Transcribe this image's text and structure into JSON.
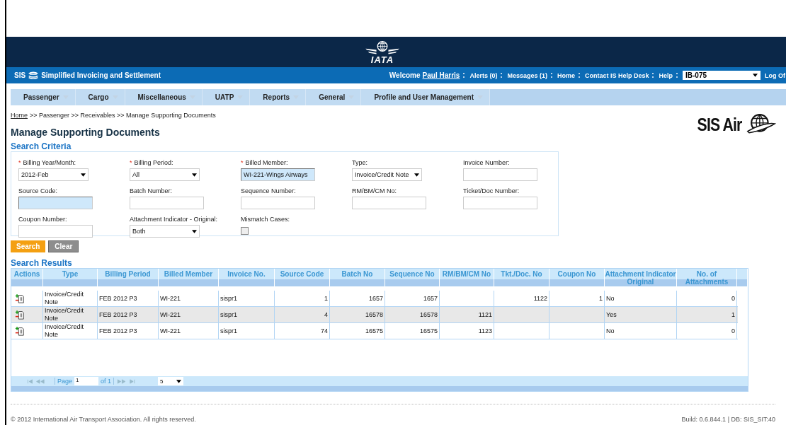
{
  "banner": {
    "logo_text": "IATA"
  },
  "app_bar": {
    "brand": "SIS",
    "title": "Simplified Invoicing and Settlement",
    "welcome": "Welcome",
    "user": "Paul Harris",
    "links": [
      "Alerts (0)",
      "Messages (1)",
      "Home",
      "Contact IS Help Desk",
      "Help"
    ],
    "selector": "IB-075",
    "logout": "Log Of"
  },
  "menu": [
    "Passenger",
    "Cargo",
    "Miscellaneous",
    "UATP",
    "Reports",
    "General",
    "Profile and User Management"
  ],
  "breadcrumb": {
    "home": "Home",
    "rest": ">> Passenger >> Receivables >> Manage Supporting Documents"
  },
  "page_title": "Manage Supporting Documents",
  "logo": {
    "text": "SIS Air"
  },
  "search_criteria": {
    "title": "Search Criteria",
    "fields": [
      {
        "kind": "select",
        "label": "Billing Year/Month:",
        "required_mark": "*",
        "value": "2012-Feb",
        "highlighted": false
      },
      {
        "kind": "select",
        "label": "Billing Period:",
        "required_mark": "*",
        "value": "All",
        "highlighted": false
      },
      {
        "kind": "input",
        "label": "Billed Member:",
        "required_mark": "*",
        "value": "WI-221-Wings Airways",
        "highlighted": true
      },
      {
        "kind": "select",
        "label": "Type:",
        "value": "Invoice/Credit Note",
        "highlighted": false
      },
      {
        "kind": "input",
        "label": "Invoice Number:",
        "highlighted": false
      },
      {
        "kind": "input",
        "label": "Source Code:",
        "highlighted": true
      },
      {
        "kind": "input",
        "label": "Batch Number:",
        "highlighted": false
      },
      {
        "kind": "input",
        "label": "Sequence Number:",
        "highlighted": false
      },
      {
        "kind": "input",
        "label": "RM/BM/CM No:",
        "highlighted": false
      },
      {
        "kind": "input",
        "label": "Ticket/Doc Number:",
        "highlighted": false
      },
      {
        "kind": "input",
        "label": "Coupon Number:",
        "highlighted": false
      },
      {
        "kind": "select",
        "label": "Attachment Indicator - Original:",
        "value": "Both",
        "highlighted": false
      },
      {
        "kind": "checkbox",
        "label": "Mismatch Cases:",
        "checked": false,
        "highlighted": false
      }
    ],
    "buttons": [
      {
        "label": "Search",
        "kind": "primary"
      },
      {
        "label": "Clear",
        "kind": "secondary"
      }
    ]
  },
  "search_results": {
    "title": "Search Results",
    "columns": [
      "Actions",
      "Type",
      "Billing Period",
      "Billed Member",
      "Invoice No.",
      "Source Code",
      "Batch No",
      "Sequence No",
      "RM/BM/CM No",
      "Tkt./Doc. No",
      "Coupon No",
      "Attachment Indicator Original",
      "No. of Attachments"
    ],
    "rows": [
      {
        "selected": false,
        "cells": {
          "type": "Invoice/Credit Note",
          "billing_period": "FEB 2012 P3",
          "billed_member": "WI-221",
          "invoice_no": "sispr1",
          "source_code": "1",
          "batch_no": "1657",
          "sequence_no": "1657",
          "tkt_doc_no": "1122",
          "coupon_no": "1",
          "attachment_indicator": "No",
          "attachments": "0"
        }
      },
      {
        "selected": true,
        "cells": {
          "type": "Invoice/Credit Note",
          "billing_period": "FEB 2012 P3",
          "billed_member": "WI-221",
          "invoice_no": "sispr1",
          "source_code": "4",
          "batch_no": "16578",
          "sequence_no": "16578",
          "rm_bm_cm_no": "1121",
          "attachment_indicator": "Yes",
          "attachments": "1"
        }
      },
      {
        "selected": false,
        "cells": {
          "type": "Invoice/Credit Note",
          "billing_period": "FEB 2012 P3",
          "billed_member": "WI-221",
          "invoice_no": "sispr1",
          "source_code": "74",
          "batch_no": "16575",
          "sequence_no": "16575",
          "rm_bm_cm_no": "1123",
          "attachment_indicator": "No",
          "attachments": "0"
        }
      }
    ],
    "pager": {
      "page_label": "Page",
      "page": "1",
      "of": "of 1",
      "page_size": "5"
    }
  },
  "footer": {
    "copyright": "© 2012 International Air Transport Association. All rights reserved.",
    "build": "Build: 0.6.844.1 | DB: SIS_SIT:40"
  }
}
